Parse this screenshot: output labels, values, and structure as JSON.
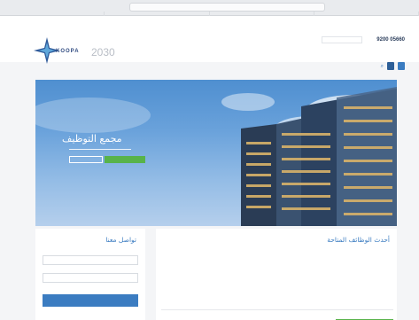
{
  "browser": {
    "url": "",
    "tabs": [
      "",
      "",
      "",
      ""
    ]
  },
  "header": {
    "logo_text": "KOOPA",
    "logo_subtitle": "",
    "vision_text": "2030",
    "phone": "9200 05660",
    "search_placeholder": ""
  },
  "nav": {
    "btn_primary": "",
    "btn_secondary": "",
    "items": [
      "",
      "",
      "",
      ""
    ]
  },
  "hero": {
    "title": "مجمع التوظيف",
    "btn_ghost": "",
    "btn_green": ""
  },
  "jobs_panel": {
    "title": "أحدث الوظائف المتاحة",
    "rows": [
      [
        "",
        "",
        "",
        ""
      ],
      [
        "",
        "",
        "",
        ""
      ],
      [
        "",
        "",
        "",
        ""
      ]
    ],
    "tabs": [
      "",
      "",
      "",
      ""
    ]
  },
  "contact_panel": {
    "title": "تواصل معنا",
    "field1_placeholder": "",
    "field2_placeholder": "",
    "submit_label": ""
  },
  "colors": {
    "primary": "#3b7cc1",
    "accent": "#58b34a",
    "header_bg": "#ffffff",
    "page_bg": "#f4f5f7"
  }
}
